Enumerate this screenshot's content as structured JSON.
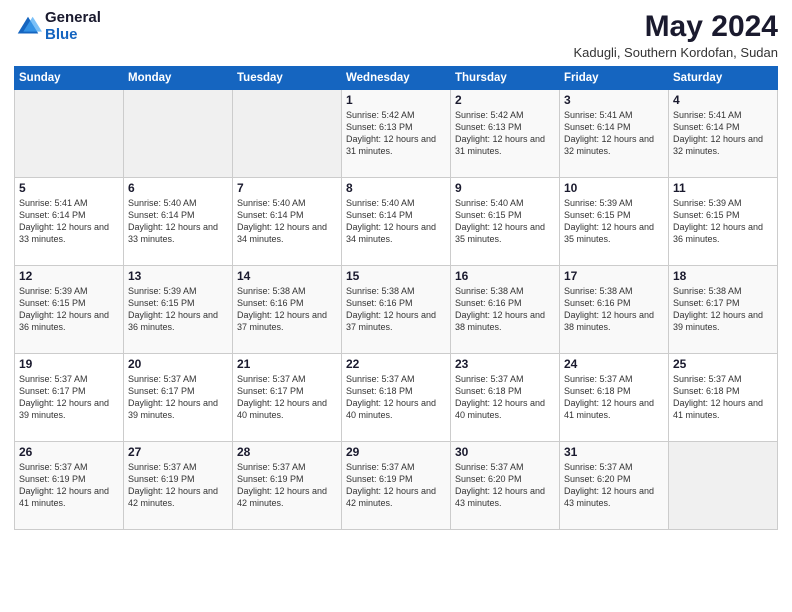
{
  "header": {
    "logo_general": "General",
    "logo_blue": "Blue",
    "title": "May 2024",
    "subtitle": "Kadugli, Southern Kordofan, Sudan"
  },
  "columns": [
    "Sunday",
    "Monday",
    "Tuesday",
    "Wednesday",
    "Thursday",
    "Friday",
    "Saturday"
  ],
  "weeks": [
    [
      {
        "day": "",
        "info": ""
      },
      {
        "day": "",
        "info": ""
      },
      {
        "day": "",
        "info": ""
      },
      {
        "day": "1",
        "info": "Sunrise: 5:42 AM\nSunset: 6:13 PM\nDaylight: 12 hours\nand 31 minutes."
      },
      {
        "day": "2",
        "info": "Sunrise: 5:42 AM\nSunset: 6:13 PM\nDaylight: 12 hours\nand 31 minutes."
      },
      {
        "day": "3",
        "info": "Sunrise: 5:41 AM\nSunset: 6:14 PM\nDaylight: 12 hours\nand 32 minutes."
      },
      {
        "day": "4",
        "info": "Sunrise: 5:41 AM\nSunset: 6:14 PM\nDaylight: 12 hours\nand 32 minutes."
      }
    ],
    [
      {
        "day": "5",
        "info": "Sunrise: 5:41 AM\nSunset: 6:14 PM\nDaylight: 12 hours\nand 33 minutes."
      },
      {
        "day": "6",
        "info": "Sunrise: 5:40 AM\nSunset: 6:14 PM\nDaylight: 12 hours\nand 33 minutes."
      },
      {
        "day": "7",
        "info": "Sunrise: 5:40 AM\nSunset: 6:14 PM\nDaylight: 12 hours\nand 34 minutes."
      },
      {
        "day": "8",
        "info": "Sunrise: 5:40 AM\nSunset: 6:14 PM\nDaylight: 12 hours\nand 34 minutes."
      },
      {
        "day": "9",
        "info": "Sunrise: 5:40 AM\nSunset: 6:15 PM\nDaylight: 12 hours\nand 35 minutes."
      },
      {
        "day": "10",
        "info": "Sunrise: 5:39 AM\nSunset: 6:15 PM\nDaylight: 12 hours\nand 35 minutes."
      },
      {
        "day": "11",
        "info": "Sunrise: 5:39 AM\nSunset: 6:15 PM\nDaylight: 12 hours\nand 36 minutes."
      }
    ],
    [
      {
        "day": "12",
        "info": "Sunrise: 5:39 AM\nSunset: 6:15 PM\nDaylight: 12 hours\nand 36 minutes."
      },
      {
        "day": "13",
        "info": "Sunrise: 5:39 AM\nSunset: 6:15 PM\nDaylight: 12 hours\nand 36 minutes."
      },
      {
        "day": "14",
        "info": "Sunrise: 5:38 AM\nSunset: 6:16 PM\nDaylight: 12 hours\nand 37 minutes."
      },
      {
        "day": "15",
        "info": "Sunrise: 5:38 AM\nSunset: 6:16 PM\nDaylight: 12 hours\nand 37 minutes."
      },
      {
        "day": "16",
        "info": "Sunrise: 5:38 AM\nSunset: 6:16 PM\nDaylight: 12 hours\nand 38 minutes."
      },
      {
        "day": "17",
        "info": "Sunrise: 5:38 AM\nSunset: 6:16 PM\nDaylight: 12 hours\nand 38 minutes."
      },
      {
        "day": "18",
        "info": "Sunrise: 5:38 AM\nSunset: 6:17 PM\nDaylight: 12 hours\nand 39 minutes."
      }
    ],
    [
      {
        "day": "19",
        "info": "Sunrise: 5:37 AM\nSunset: 6:17 PM\nDaylight: 12 hours\nand 39 minutes."
      },
      {
        "day": "20",
        "info": "Sunrise: 5:37 AM\nSunset: 6:17 PM\nDaylight: 12 hours\nand 39 minutes."
      },
      {
        "day": "21",
        "info": "Sunrise: 5:37 AM\nSunset: 6:17 PM\nDaylight: 12 hours\nand 40 minutes."
      },
      {
        "day": "22",
        "info": "Sunrise: 5:37 AM\nSunset: 6:18 PM\nDaylight: 12 hours\nand 40 minutes."
      },
      {
        "day": "23",
        "info": "Sunrise: 5:37 AM\nSunset: 6:18 PM\nDaylight: 12 hours\nand 40 minutes."
      },
      {
        "day": "24",
        "info": "Sunrise: 5:37 AM\nSunset: 6:18 PM\nDaylight: 12 hours\nand 41 minutes."
      },
      {
        "day": "25",
        "info": "Sunrise: 5:37 AM\nSunset: 6:18 PM\nDaylight: 12 hours\nand 41 minutes."
      }
    ],
    [
      {
        "day": "26",
        "info": "Sunrise: 5:37 AM\nSunset: 6:19 PM\nDaylight: 12 hours\nand 41 minutes."
      },
      {
        "day": "27",
        "info": "Sunrise: 5:37 AM\nSunset: 6:19 PM\nDaylight: 12 hours\nand 42 minutes."
      },
      {
        "day": "28",
        "info": "Sunrise: 5:37 AM\nSunset: 6:19 PM\nDaylight: 12 hours\nand 42 minutes."
      },
      {
        "day": "29",
        "info": "Sunrise: 5:37 AM\nSunset: 6:19 PM\nDaylight: 12 hours\nand 42 minutes."
      },
      {
        "day": "30",
        "info": "Sunrise: 5:37 AM\nSunset: 6:20 PM\nDaylight: 12 hours\nand 43 minutes."
      },
      {
        "day": "31",
        "info": "Sunrise: 5:37 AM\nSunset: 6:20 PM\nDaylight: 12 hours\nand 43 minutes."
      },
      {
        "day": "",
        "info": ""
      }
    ]
  ]
}
